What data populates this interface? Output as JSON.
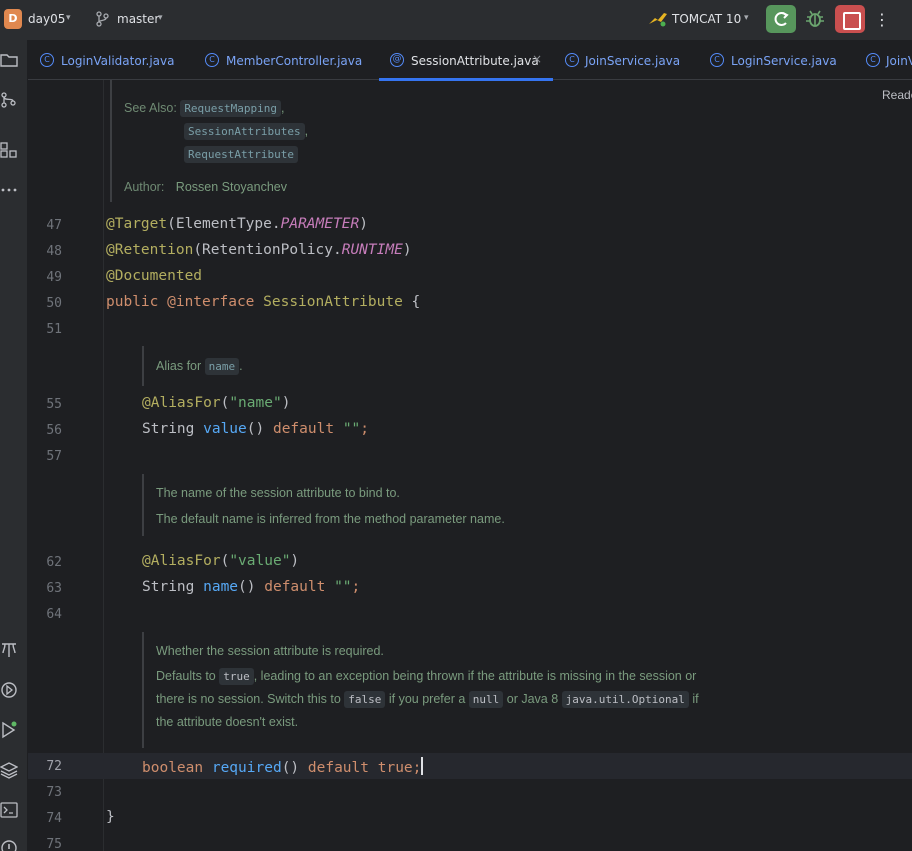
{
  "project": {
    "badge": "D",
    "name": "day05"
  },
  "vcs": {
    "branch": "master"
  },
  "run_config": {
    "name": "TOMCAT 10"
  },
  "toolbar": {
    "more": "⋮"
  },
  "tabs": [
    {
      "label": "LoginValidator.java",
      "icon": "C"
    },
    {
      "label": "MemberController.java",
      "icon": "C"
    },
    {
      "label": "SessionAttribute.java",
      "icon": "@",
      "active": true
    },
    {
      "label": "JoinService.java",
      "icon": "C"
    },
    {
      "label": "LoginService.java",
      "icon": "C"
    },
    {
      "label": "JoinV",
      "icon": "C"
    }
  ],
  "tab_close": "×",
  "reader_mode": "Reade",
  "doc_top": {
    "see_also_label": "See Also:",
    "see_also": [
      "RequestMapping",
      "SessionAttributes",
      "RequestAttribute"
    ],
    "author_label": "Author:",
    "author": "Rossen Stoyanchev"
  },
  "line_numbers": [
    "47",
    "48",
    "49",
    "50",
    "51",
    "55",
    "56",
    "57",
    "62",
    "63",
    "64",
    "72",
    "73",
    "74",
    "75"
  ],
  "code": {
    "l47_a": "@Target",
    "l47_b": "(ElementType.",
    "l47_c": "PARAMETER",
    "l47_d": ")",
    "l48_a": "@Retention",
    "l48_b": "(RetentionPolicy.",
    "l48_c": "RUNTIME",
    "l48_d": ")",
    "l49": "@Documented",
    "l50_a": "public ",
    "l50_b": "@interface ",
    "l50_c": "SessionAttribute",
    "l50_d": " {",
    "l55_a": "@AliasFor",
    "l55_b": "(",
    "l55_c": "\"name\"",
    "l55_d": ")",
    "l56_a": "String ",
    "l56_b": "value",
    "l56_c": "() ",
    "l56_d": "default ",
    "l56_e": "\"\"",
    "l56_f": ";",
    "l62_a": "@AliasFor",
    "l62_b": "(",
    "l62_c": "\"value\"",
    "l62_d": ")",
    "l63_a": "String ",
    "l63_b": "name",
    "l63_c": "() ",
    "l63_d": "default ",
    "l63_e": "\"\"",
    "l63_f": ";",
    "l72_a": "boolean ",
    "l72_b": "required",
    "l72_c": "() ",
    "l72_d": "default ",
    "l72_e": "true",
    "l72_f": ";",
    "l74": "}"
  },
  "doc_alias": {
    "text": "Alias for ",
    "chip": "name",
    "end": "."
  },
  "doc_name": {
    "line1": "The name of the session attribute to bind to.",
    "line2": "The default name is inferred from the method parameter name."
  },
  "doc_required": {
    "line1": "Whether the session attribute is required.",
    "line2_a": "Defaults to ",
    "line2_chip": "true",
    "line2_b": ", leading to an exception being thrown if the attribute is missing in the session or",
    "line3_a": "there is no session. Switch this to ",
    "line3_chip1": "false",
    "line3_b": " if you prefer a ",
    "line3_chip2": "null",
    "line3_c": " or Java 8 ",
    "line3_chip3": "java.util.Optional",
    "line3_d": " if",
    "line4": "the attribute doesn't exist."
  }
}
